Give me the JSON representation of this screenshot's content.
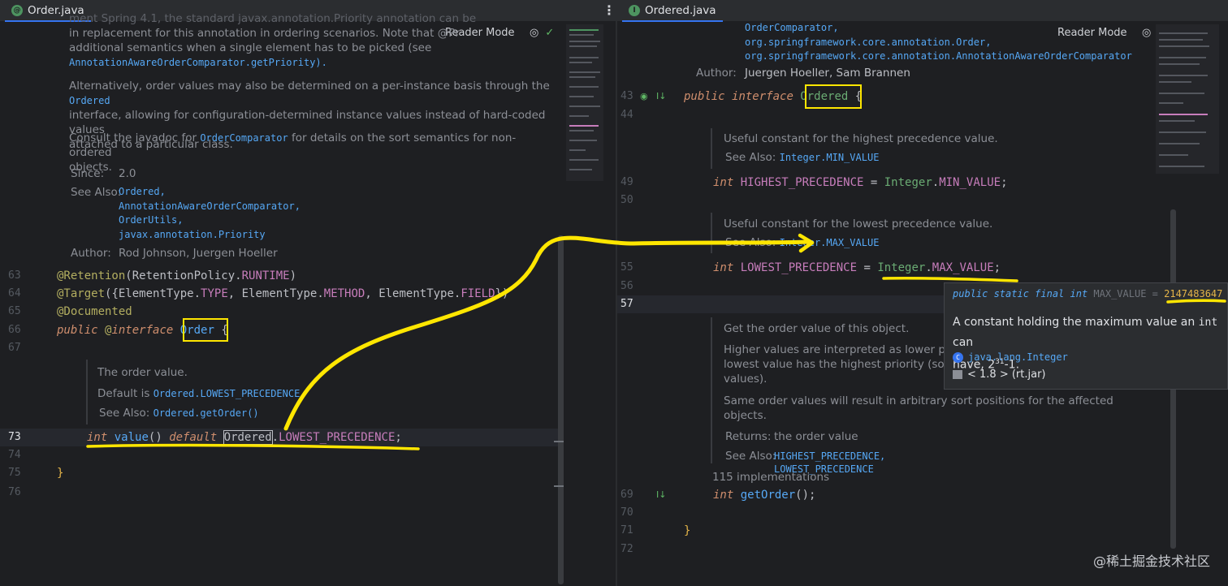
{
  "left": {
    "tab_label": "Order.java",
    "reader_mode": "Reader Mode",
    "doc_intro": [
      "ment Spring 4.1, the standard javax.annotation.Priority annotation can be used as a drop-",
      "in replacement for this annotation in ordering scenarios. Note that @Pr",
      "additional semantics when a single element has to be picked (see",
      "AnnotationAwareOrderComparator.getPriority)."
    ],
    "doc_alt": [
      "Alternatively, order values may also be determined on a per-instance basis through the",
      "Ordered",
      "interface, allowing for configuration-determined instance values instead of hard-coded values",
      "attached to a particular class."
    ],
    "doc_consult_pre": "Consult the javadoc for",
    "doc_consult_link": "OrderComparator",
    "doc_consult_post": "for details on the sort semantics for non-ordered",
    "doc_consult_line2": "objects.",
    "since_label": "Since:",
    "since_value": "2.0",
    "see_also_label": "See Also:",
    "see_also": [
      "Ordered,",
      "AnnotationAwareOrderComparator,",
      "OrderUtils,",
      "javax.annotation.Priority"
    ],
    "author_label": "Author:",
    "author_value": "Rod Johnson, Juergen Hoeller",
    "line_numbers": [
      "63",
      "64",
      "65",
      "66",
      "67",
      "73",
      "74",
      "75",
      "76"
    ],
    "code": {
      "l63_ann": "@Retention",
      "l63_rest": "(RetentionPolicy.",
      "l63_const": "RUNTIME",
      "l63_end": ")",
      "l64_ann": "@Target",
      "l64_a": "({ElementType.",
      "l64_b": "TYPE",
      "l64_c": ", ElementType.",
      "l64_d": "METHOD",
      "l64_e": ", ElementType.",
      "l64_f": "FIELD",
      "l64_g": "})",
      "l65_ann": "@Documented",
      "l66_kw": "public",
      "l66_at": "@",
      "l66_kw2": "interface",
      "l66_name": "Order",
      "l66_brace": "{",
      "l73_kw": "int",
      "l73_name": "value",
      "l73_paren": "()",
      "l73_kw2": "default",
      "l73_type": "Ordered",
      "l73_dot": ".",
      "l73_const": "LOWEST_PRECEDENCE",
      "l73_semi": ";",
      "l75_brace": "}"
    },
    "value_doc": {
      "desc": "The order value.",
      "default_label": "Default is",
      "default_value": "Ordered.LOWEST_PRECEDENCE.",
      "see_label": "See Also:",
      "see_value": "Ordered.getOrder()"
    }
  },
  "right": {
    "tab_label": "Ordered.java",
    "reader_mode": "Reader Mode",
    "see_top": [
      "OrderComparator,",
      "org.springframework.core.annotation.Order,",
      "org.springframework.core.annotation.AnnotationAwareOrderComparator"
    ],
    "author_label": "Author:",
    "author_value": "Juergen Hoeller, Sam Brannen",
    "line_numbers": [
      "43",
      "44",
      "49",
      "50",
      "55",
      "56",
      "57",
      "69",
      "70",
      "71",
      "72"
    ],
    "code": {
      "l43_kw": "public",
      "l43_kw2": "interface",
      "l43_name": "Ordered",
      "l43_brace": "{",
      "l49_kw": "int",
      "l49_name": "HIGHEST_PRECEDENCE",
      "l49_eq": " = ",
      "l49_cls": "Integer",
      "l49_dot": ".",
      "l49_const": "MIN_VALUE",
      "l49_semi": ";",
      "l55_kw": "int",
      "l55_name": "LOWEST_PRECEDENCE",
      "l55_eq": " = ",
      "l55_cls": "Integer",
      "l55_dot": ".",
      "l55_const": "MAX_VALUE",
      "l55_semi": ";",
      "l69_kw": "int",
      "l69_name": "getOrder",
      "l69_paren": "();",
      "l71_brace": "}"
    },
    "highest_doc": {
      "desc": "Useful constant for the highest precedence value.",
      "see_label": "See Also:",
      "see_value": "Integer.MIN_VALUE"
    },
    "lowest_doc": {
      "desc": "Useful constant for the lowest precedence value.",
      "see_label": "See Also:",
      "see_value": "Integer.MAX_VALUE"
    },
    "getorder_doc": {
      "p1": "Get the order value of this object.",
      "p2a": "Higher values are interpreted as lower priori",
      "p2b": "lowest value has the highest priority (somew",
      "p2c": "values).",
      "p3": "Same order values will result in arbitrary sort positions for the affected objects.",
      "returns_label": "Returns:",
      "returns_value": "the order value",
      "see_label": "See Also:",
      "see_values": [
        "HIGHEST_PRECEDENCE,",
        "LOWEST_PRECEDENCE"
      ]
    },
    "implementations": "115 implementations"
  },
  "tooltip": {
    "sig_mods": "public static final int",
    "sig_name": "MAX_VALUE =",
    "sig_value": "2147483647",
    "body_pre": "A constant holding the maximum value an",
    "body_code": "int",
    "body_post": "can",
    "body_line2_pre": "have, 2",
    "body_sup": "31",
    "body_line2_post": "-1.",
    "class_name": "java.lang.Integer",
    "jar": "< 1.8 > (rt.jar)"
  },
  "watermark": "@稀土掘金技术社区",
  "colors": {
    "highlight": "#ffe600",
    "background": "#1e1f22",
    "accent": "#3574f0"
  }
}
